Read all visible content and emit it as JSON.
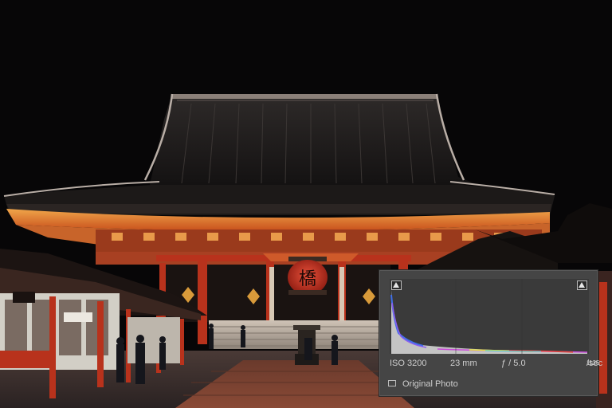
{
  "photo": {
    "lantern_characters": "橋",
    "subject": "temple-hall-at-night"
  },
  "histogram_panel": {
    "clip_shadow_icon": "triangle-up-icon",
    "clip_highlight_icon": "triangle-up-icon",
    "exif": {
      "iso": "ISO 3200",
      "focal_length": "23 mm",
      "aperture": "ƒ / 5.0",
      "shutter_num": "1",
      "shutter_den": "125",
      "shutter_unit": "sec"
    },
    "original_photo_label": "Original Photo",
    "original_photo_checked": false
  },
  "colors": {
    "panel_bg": "#454545",
    "histogram_bg": "#3a3a3a",
    "temple_red": "#b8321c",
    "lantern_red": "#c8301e",
    "sky": "#070607"
  }
}
